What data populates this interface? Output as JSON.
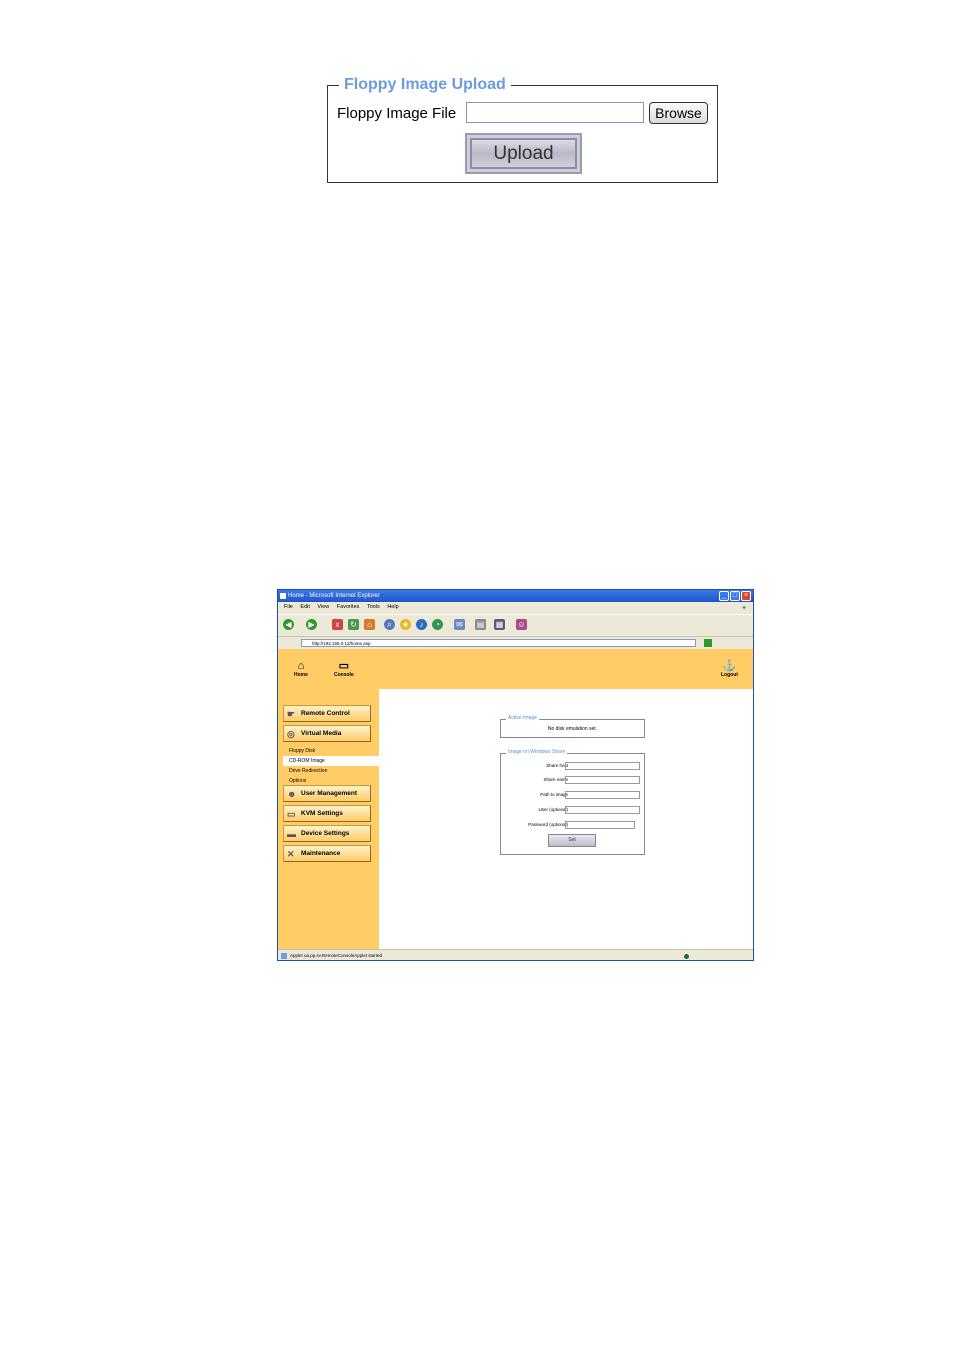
{
  "floppy_upload": {
    "legend": "Floppy Image Upload",
    "file_label": "Floppy Image File",
    "file_value": "",
    "browse_label": "Browse",
    "upload_label": "Upload",
    "legend_color": "#6b9be0"
  },
  "browser": {
    "title": "Home - Microsoft Internet Explorer",
    "menu": [
      "File",
      "Edit",
      "View",
      "Favorites",
      "Tools",
      "Help"
    ],
    "address": "http://192.168.0.12/home.asp",
    "status": "Applet ua.pp.sv.RemoteConsoleApplet started",
    "header": {
      "home_label": "Home",
      "console_label": "Console",
      "logout_label": "Logout"
    },
    "nav": {
      "remote_control": "Remote Control",
      "virtual_media": "Virtual Media",
      "sub_items": [
        "Floppy Disk",
        "CD-ROM Image",
        "Drive Redirection",
        "Options"
      ],
      "user_management": "User Management",
      "kvm_settings": "KVM Settings",
      "device_settings": "Device Settings",
      "maintenance": "Maintenance"
    },
    "active_image": {
      "legend": "Active Image",
      "text": "No disk emulation set."
    },
    "windows_share": {
      "legend": "Image on Windows Share",
      "fields": [
        "Share host",
        "Share name",
        "Path to image",
        "User (optional)",
        "Password (optional)"
      ],
      "set_label": "Set"
    },
    "colors": {
      "band": "#ffcc66",
      "titlebar": "#1d55c9"
    }
  }
}
